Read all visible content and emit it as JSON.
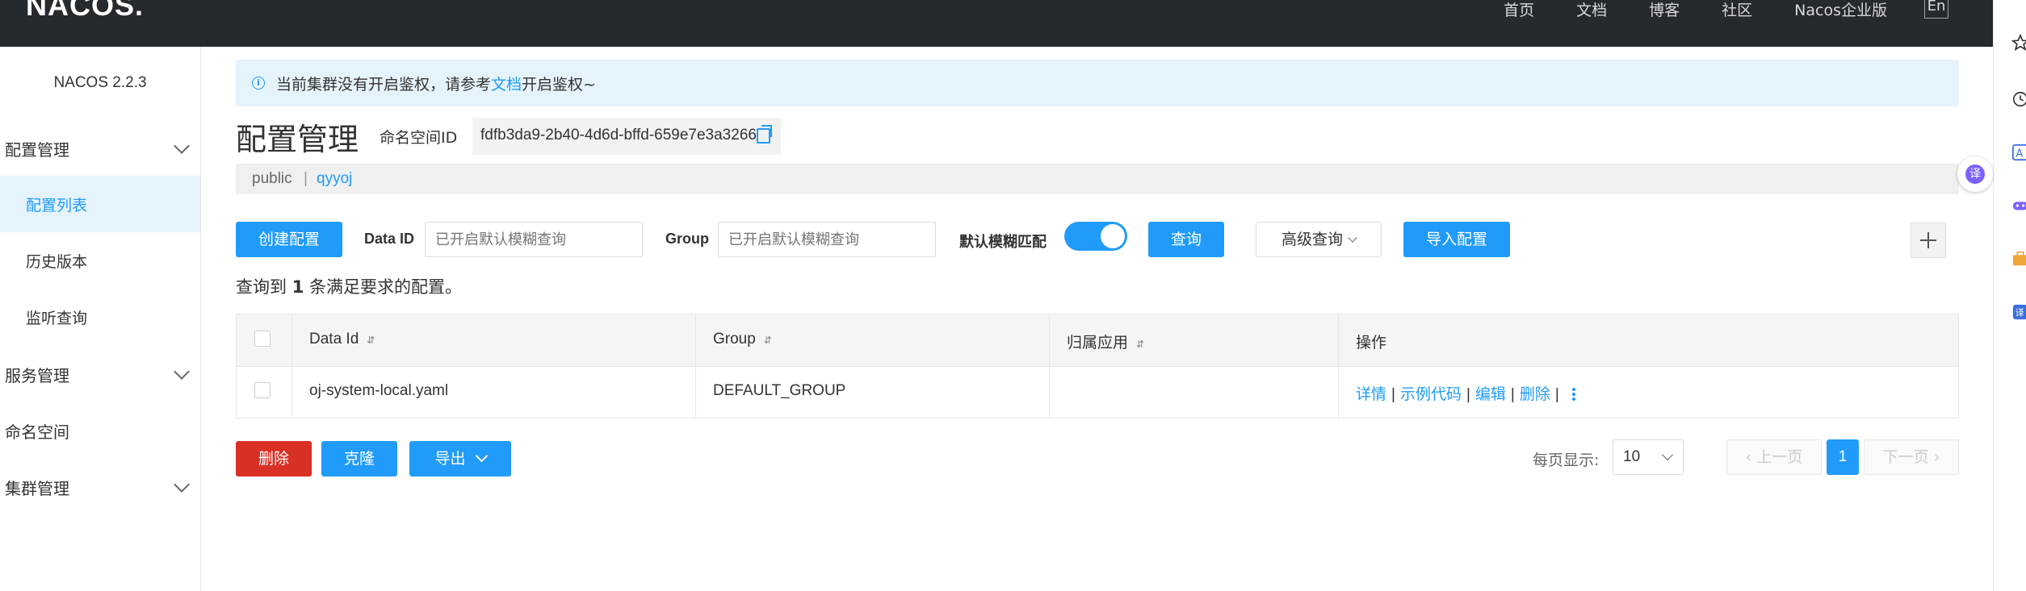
{
  "topbar": {
    "logo": "NACOS.",
    "nav": [
      "首页",
      "文档",
      "博客",
      "社区",
      "Nacos企业版"
    ],
    "lang": "En"
  },
  "sidebar": {
    "version": "NACOS 2.2.3",
    "groups": {
      "config": "配置管理",
      "service": "服务管理",
      "namespace": "命名空间",
      "cluster": "集群管理"
    },
    "config_items": [
      "配置列表",
      "历史版本",
      "监听查询"
    ]
  },
  "notice": {
    "text_before": "当前集群没有开启鉴权，请参考",
    "link": "文档",
    "text_after": "开启鉴权~"
  },
  "page": {
    "title": "配置管理",
    "ns_label": "命名空间ID",
    "ns_id": "fdfb3da9-2b40-4d6d-bffd-659e7e3a3266",
    "ns_tabs": [
      "public",
      "|",
      "qyyoj"
    ]
  },
  "toolbar": {
    "create": "创建配置",
    "data_id_label": "Data ID",
    "data_id_placeholder": "已开启默认模糊查询",
    "group_label": "Group",
    "group_placeholder": "已开启默认模糊查询",
    "fuzzy_label": "默认模糊匹配",
    "fuzzy_on": true,
    "query": "查询",
    "advanced": "高级查询",
    "import": "导入配置"
  },
  "result": {
    "prefix": "查询到",
    "count": "1",
    "suffix": "条满足要求的配置。"
  },
  "table": {
    "headers": [
      "Data Id",
      "Group",
      "归属应用",
      "操作"
    ],
    "rows": [
      {
        "data_id": "oj-system-local.yaml",
        "group": "DEFAULT_GROUP",
        "app": "",
        "ops": [
          "详情",
          "示例代码",
          "编辑",
          "删除"
        ]
      }
    ]
  },
  "footer": {
    "delete": "删除",
    "clone": "克隆",
    "export": "导出",
    "page_size_label": "每页显示:",
    "page_size": "10",
    "prev": "上一页",
    "current_page": "1",
    "next": "下一页"
  },
  "colors": {
    "primary": "#209bfa",
    "danger": "#d93026",
    "topbar": "#252a2f",
    "notice_bg": "#e5f3fd"
  }
}
